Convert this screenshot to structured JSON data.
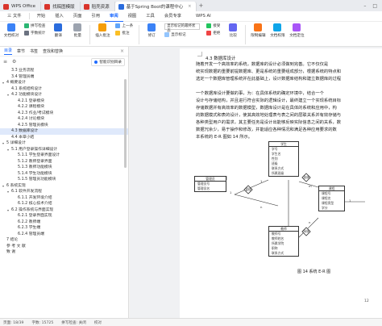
{
  "titlebar": {
    "tabs": [
      {
        "label": "WPS Office",
        "color": "#d9342b"
      },
      {
        "label": "找稿图模版",
        "color": "#d9342b"
      },
      {
        "label": "稻壳资源",
        "color": "#d9342b"
      },
      {
        "label": "基于Spring Boot的课程中心",
        "color": "#2a6cdd"
      }
    ],
    "add": "+",
    "close": "×"
  },
  "menubar": {
    "file": "三 文件",
    "items": [
      "开始",
      "插入",
      "页面",
      "引用",
      "审阅",
      "视图",
      "工具",
      "会员专享"
    ],
    "active": "审阅",
    "wps_ai": "WPS AI"
  },
  "ribbon": {
    "doc_check": "文档校对",
    "proof": "拼写检查",
    "word_count": "字数统计",
    "translate": "翻译",
    "batch": "批量",
    "insert_comment": "插入批注",
    "prev": "上一条",
    "comment_label": "批注",
    "track_changes": "修订",
    "display": "显示标记的最终状态",
    "display_markup": "显示标记",
    "accept": "接受",
    "reject": "拒绝",
    "compare": "比较",
    "restrict_edit": "限制编辑",
    "doc_permission": "文档权限",
    "doc_locate": "文档定位"
  },
  "nav": {
    "tabs": [
      "目录",
      "章节",
      "书签",
      "查找和替换"
    ],
    "active_tab": "目录",
    "smart_toc": "智能识别目录",
    "toc": [
      {
        "label": "3.3 业务流程",
        "level": 2
      },
      {
        "label": "3.4 管理员端",
        "level": 2
      },
      {
        "label": "4 概要设计",
        "level": 1,
        "caret": true
      },
      {
        "label": "4.1 系统结构设计",
        "level": 2
      },
      {
        "label": "4.2 功能模块设计",
        "level": 2,
        "caret": true
      },
      {
        "label": "4.2.1 登录模块",
        "level": 3
      },
      {
        "label": "4.2.2 课程模块",
        "level": 3
      },
      {
        "label": "4.2.3 作业/考试模块",
        "level": 3
      },
      {
        "label": "4.2.4 讨论模块",
        "level": 3
      },
      {
        "label": "4.2.5 管理员模块",
        "level": 3
      },
      {
        "label": "4.3 数据库设计",
        "level": 2,
        "active": true
      },
      {
        "label": "4.4 本章小结",
        "level": 2
      },
      {
        "label": "5 详细设计",
        "level": 1,
        "caret": true
      },
      {
        "label": "5.1 用户登录操作详细设计",
        "level": 2,
        "caret": true
      },
      {
        "label": "5.1.1 学生登录界面设计",
        "level": 3
      },
      {
        "label": "5.1.2 教师登录界面",
        "level": 3
      },
      {
        "label": "5.1.3 教师功能模块",
        "level": 3
      },
      {
        "label": "5.1.4 学生功能模块",
        "level": 3
      },
      {
        "label": "5.1.5 管理员功能模块",
        "level": 3
      },
      {
        "label": "6 系统实现",
        "level": 1,
        "caret": true
      },
      {
        "label": "6.1 软件开发流程",
        "level": 2,
        "caret": true
      },
      {
        "label": "6.1.1 开发环境介绍",
        "level": 3
      },
      {
        "label": "6.1.2 核心技术介绍",
        "level": 3
      },
      {
        "label": "6.2 操作系统与界面实现",
        "level": 2,
        "caret": true
      },
      {
        "label": "6.2.1 登录界面实现",
        "level": 3
      },
      {
        "label": "6.2.2 教师端",
        "level": 3
      },
      {
        "label": "6.2.3 学生端",
        "level": 3
      },
      {
        "label": "6.2.4 管理员端",
        "level": 3
      },
      {
        "label": "7 结论",
        "level": 1
      },
      {
        "label": "参 考 文 献",
        "level": 1
      },
      {
        "label": "致 谢",
        "level": 1
      }
    ]
  },
  "doc": {
    "heading": "4.3 数据库设计",
    "paragraphs": [
      "随着开发一个高效率的系统，数据库的设计必须做到完善。它不仅仅是",
      "统实现数据的重要前提数据库、更是系统的重要组成部分，根据系统的特点和",
      "选定一个数据库管理系统并在此基础上，设计数据库结构和建立数据库的过程",
      "一个数据库设计要做的事，为：在具体系统的确定环境中，结合一个",
      "设计与存储结构，并且进行符合实际的逻辑设计，最终建立一个实现系统目标",
      "存储数据并有高效率的数据模型，数据库设计是在具体的系统和应用中，构",
      "的数据模式和表的设计，使其高效地处理表与表之间的层联关系并有效存储与",
      "各种类型用户的需求，其主要任务是设计出能够反映实际信息之间的关系，数",
      "数据冗余少，易于操作和修改，并能适应各种情况和满足各种应用要求的数",
      "本系统的 E-R 图如 14 所示。"
    ],
    "er": {
      "entities": [
        {
          "name": "学生",
          "attrs": [
            "学号",
            "学生名",
            "性别",
            "班级",
            "联系方式",
            "所属班级"
          ]
        },
        {
          "name": "管理员",
          "attrs": [
            "管理员号",
            "管理员名"
          ]
        },
        {
          "name": "教师",
          "attrs": [
            "教师号",
            "教师姓名",
            "所属学院",
            "职称",
            "联系方式"
          ]
        },
        {
          "name": "课程",
          "attrs": [
            "课程号",
            "课程名",
            "课程类型",
            "学分"
          ]
        }
      ],
      "relations": [
        "管理",
        "选课",
        "授课"
      ],
      "cardinalities": [
        "1",
        "n",
        "m",
        "n",
        "1",
        "1"
      ]
    },
    "figure_caption": "图 14 系统 E-R 图",
    "page_number": "12"
  },
  "statusbar": {
    "page": "页面: 18/39",
    "words": "字数: 15725",
    "spellcheck": "拼写检查: 关闭",
    "proof": "校对"
  },
  "colors": {
    "accent": "#1f6bff",
    "wps_red": "#d9342b"
  }
}
